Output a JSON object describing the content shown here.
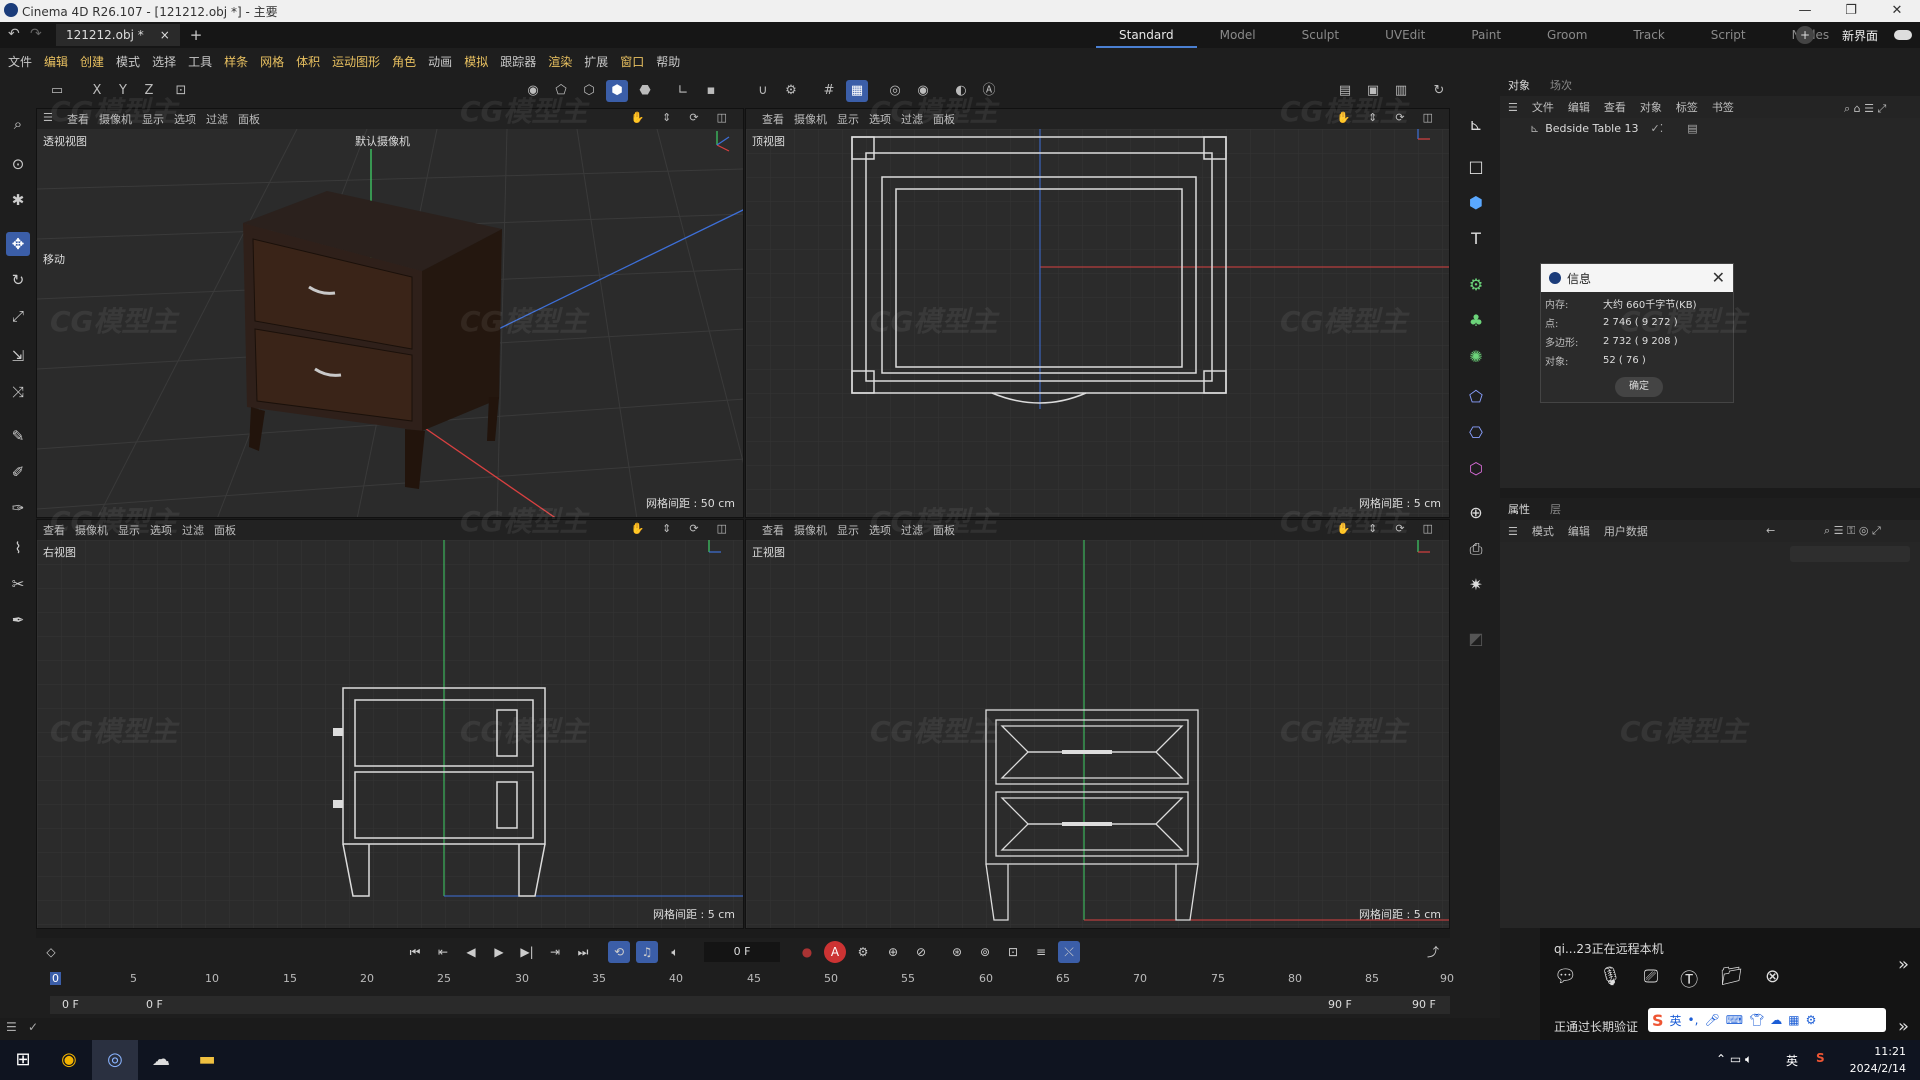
{
  "title_bar": {
    "title": "Cinema 4D R26.107 - [121212.obj *] - 主要",
    "min": "—",
    "max": "❐",
    "close": "✕"
  },
  "doc_tab": {
    "name": "121212.obj *",
    "close": "×",
    "add": "+"
  },
  "layout_tabs": [
    "Standard",
    "Model",
    "Sculpt",
    "UVEdit",
    "Paint",
    "Groom",
    "Track",
    "Script",
    "Nodes"
  ],
  "new_layout": "新界面",
  "menu": [
    "文件",
    "编辑",
    "创建",
    "模式",
    "选择",
    "工具",
    "样条",
    "网格",
    "体积",
    "运动图形",
    "角色",
    "动画",
    "模拟",
    "跟踪器",
    "渲染",
    "扩展",
    "窗口",
    "帮助"
  ],
  "axis_buttons": [
    "X",
    "Y",
    "Z"
  ],
  "viewport_menu": [
    "查看",
    "摄像机",
    "显示",
    "选项",
    "过滤",
    "面板"
  ],
  "viewports": {
    "persp": {
      "label": "透视视图",
      "camera": "默认摄像机",
      "grid": "网格间距 : 50 cm",
      "move": "移动"
    },
    "top": {
      "label": "顶视图",
      "grid": "网格间距 : 5 cm"
    },
    "right": {
      "label": "右视图",
      "grid": "网格间距 : 5 cm"
    },
    "front": {
      "label": "正视图",
      "grid": "网格间距 : 5 cm"
    }
  },
  "object_panel": {
    "tabs": [
      "对象",
      "场次"
    ],
    "menu": [
      "文件",
      "编辑",
      "查看",
      "对象",
      "标签",
      "书签"
    ],
    "object": "Bedside Table 13"
  },
  "attr_panel": {
    "tabs": [
      "属性",
      "层"
    ],
    "menu": [
      "模式",
      "编辑",
      "用户数据"
    ]
  },
  "info_dialog": {
    "title": "信息",
    "rows": [
      {
        "k": "内存:",
        "v": "大约 660千字节(KB)"
      },
      {
        "k": "点:",
        "v": "2 746 ( 9 272 )"
      },
      {
        "k": "多边形:",
        "v": "2 732 ( 9 208 )"
      },
      {
        "k": "对象:",
        "v": "52 ( 76 )"
      }
    ],
    "ok": "确定"
  },
  "timeline": {
    "frame": "0 F",
    "start": "0 F",
    "start2": "0 F",
    "end": "90 F",
    "end2": "90 F",
    "ticks": [
      "0",
      "5",
      "10",
      "15",
      "20",
      "25",
      "30",
      "35",
      "40",
      "45",
      "50",
      "55",
      "60",
      "65",
      "70",
      "75",
      "80",
      "85",
      "90"
    ]
  },
  "remote": {
    "text": "qi...23正在远程本机",
    "verify": "正通过长期验证"
  },
  "clock": {
    "time": "11:21",
    "date": "2024/2/14"
  },
  "tray": {
    "ime": "英"
  },
  "watermark": "CG模型主"
}
